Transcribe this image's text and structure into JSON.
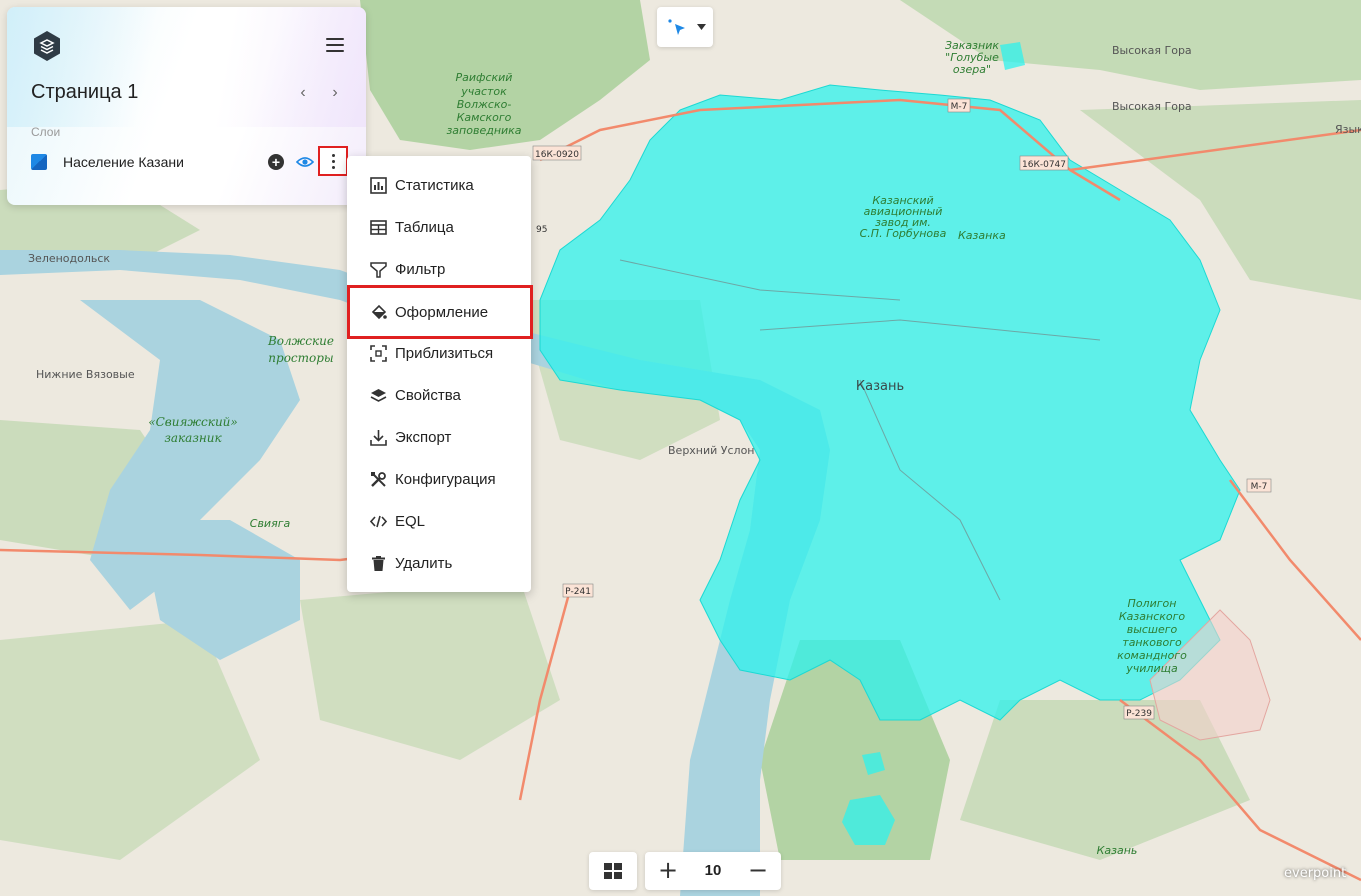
{
  "panel": {
    "page_title": "Страница 1",
    "layers_label": "Слои",
    "layer": {
      "name": "Население Казани",
      "color": "#1e88e5"
    }
  },
  "menu": {
    "items": [
      {
        "label": "Статистика",
        "icon": "bar-chart-icon"
      },
      {
        "label": "Таблица",
        "icon": "table-icon"
      },
      {
        "label": "Фильтр",
        "icon": "filter-icon"
      },
      {
        "label": "Оформление",
        "icon": "paint-bucket-icon",
        "highlighted": true
      },
      {
        "label": "Приблизиться",
        "icon": "zoom-to-fit-icon"
      },
      {
        "label": "Свойства",
        "icon": "layers-icon"
      },
      {
        "label": "Экспорт",
        "icon": "download-icon"
      },
      {
        "label": "Конфигурация",
        "icon": "tools-icon"
      },
      {
        "label": "EQL",
        "icon": "code-icon"
      },
      {
        "label": "Удалить",
        "icon": "trash-icon"
      }
    ]
  },
  "zoom": {
    "value": "10"
  },
  "attribution": "everpoint",
  "map": {
    "labels": {
      "raifa": [
        "Раифский",
        "участок",
        "Волжско-",
        "Камского",
        "заповедника"
      ],
      "golubye": [
        "Заказник",
        "\"Голубые",
        "озера\""
      ],
      "vysokaya_gora_1": "Высокая Гора",
      "vysokaya_gora_2": "Высокая Гора",
      "yasky": "Язык",
      "zelenodolsk": "Зеленодольск",
      "volzhskie": [
        "Волжские",
        "просторы"
      ],
      "nizhnie_vyazovye": "Нижние Вязовые",
      "sviyazhsky": [
        "«Свияжский»",
        "заказник"
      ],
      "sviyaga": "Свияга",
      "verkhny_uslon": "Верхний Услон",
      "kazan": "Казань",
      "aviazavod": [
        "Казанский",
        "авиационный",
        "завод им.",
        "С.П. Горбунова"
      ],
      "kazanka": "Казанка",
      "poligon": [
        "Полигон",
        "Казанского",
        "высшего",
        "танкового",
        "командного",
        "училища"
      ],
      "airport": "Казань",
      "roads": {
        "r1": "16К-0920",
        "r2": "М-7",
        "r3": "16К-0747",
        "r4": "М-7",
        "r5": "Р-241",
        "r6": "Р-239",
        "r7": "95"
      }
    },
    "colors": {
      "overlay": "#2ef2ec",
      "water": "#aad3df",
      "forest": "#add19e",
      "land": "#f2efe9"
    }
  }
}
